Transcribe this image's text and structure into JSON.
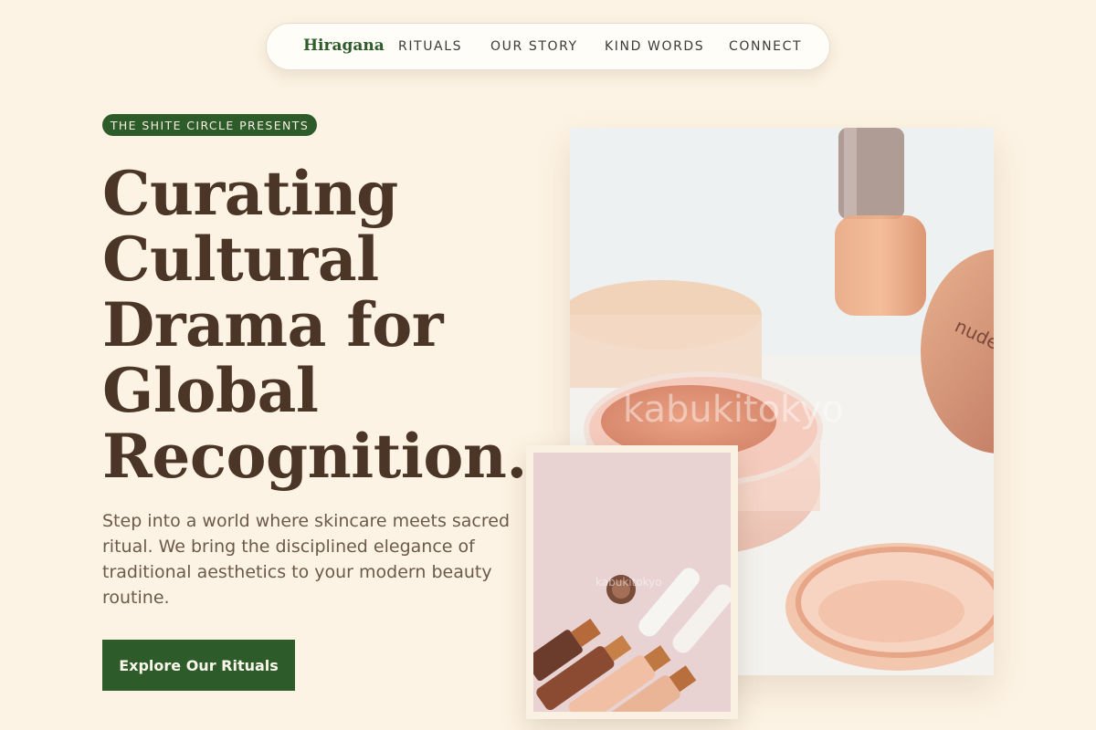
{
  "nav": {
    "brand": "Hiragana",
    "links": [
      "RITUALS",
      "OUR STORY",
      "KIND WORDS",
      "CONNECT"
    ]
  },
  "hero": {
    "badge": "THE SHITE CIRCLE PRESENTS",
    "headline_lines": [
      "Curating",
      "Cultural",
      "Drama for",
      "Global",
      "Recognition."
    ],
    "lead": "Step into a world where skincare meets sacred ritual. We bring the disciplined elegance of traditional aesthetics to your modern beauty routine.",
    "cta": "Explore Our Rituals"
  },
  "images": {
    "main": {
      "subject": "cosmetic powder jars",
      "watermark": "kabukitokyo",
      "jar_label": "nude"
    },
    "small": {
      "subject": "makeup bottles on pink",
      "watermark": "kabukitokyo"
    }
  },
  "colors": {
    "background": "#fdf3e4",
    "accent_green": "#2e5b2a",
    "headline_brown": "#4a3526",
    "body_text": "#6b5a4c"
  }
}
